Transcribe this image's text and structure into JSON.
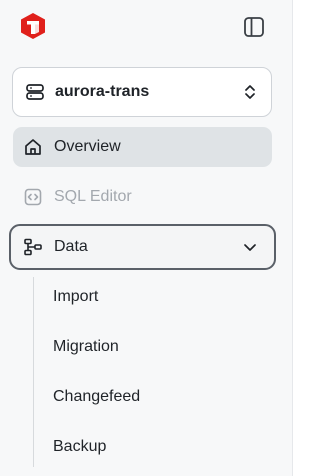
{
  "icons": {
    "logo": "brand-logo-icon",
    "collapse": "sidebar-toggle-icon",
    "cluster": "database-icon",
    "cluster_switch": "chevron-up-down-icon",
    "overview": "home-icon",
    "sql_editor": "code-editor-icon",
    "data": "data-icon",
    "data_toggle": "chevron-down-icon"
  },
  "colors": {
    "brand": "#e0201b",
    "active_bg": "#dfe3e6",
    "disabled_text": "#a3a8ae"
  },
  "cluster": {
    "name": "aurora-trans"
  },
  "nav": {
    "overview": "Overview",
    "sql_editor": "SQL Editor",
    "data": "Data"
  },
  "data_submenu": {
    "import": "Import",
    "migration": "Migration",
    "changefeed": "Changefeed",
    "backup": "Backup"
  }
}
